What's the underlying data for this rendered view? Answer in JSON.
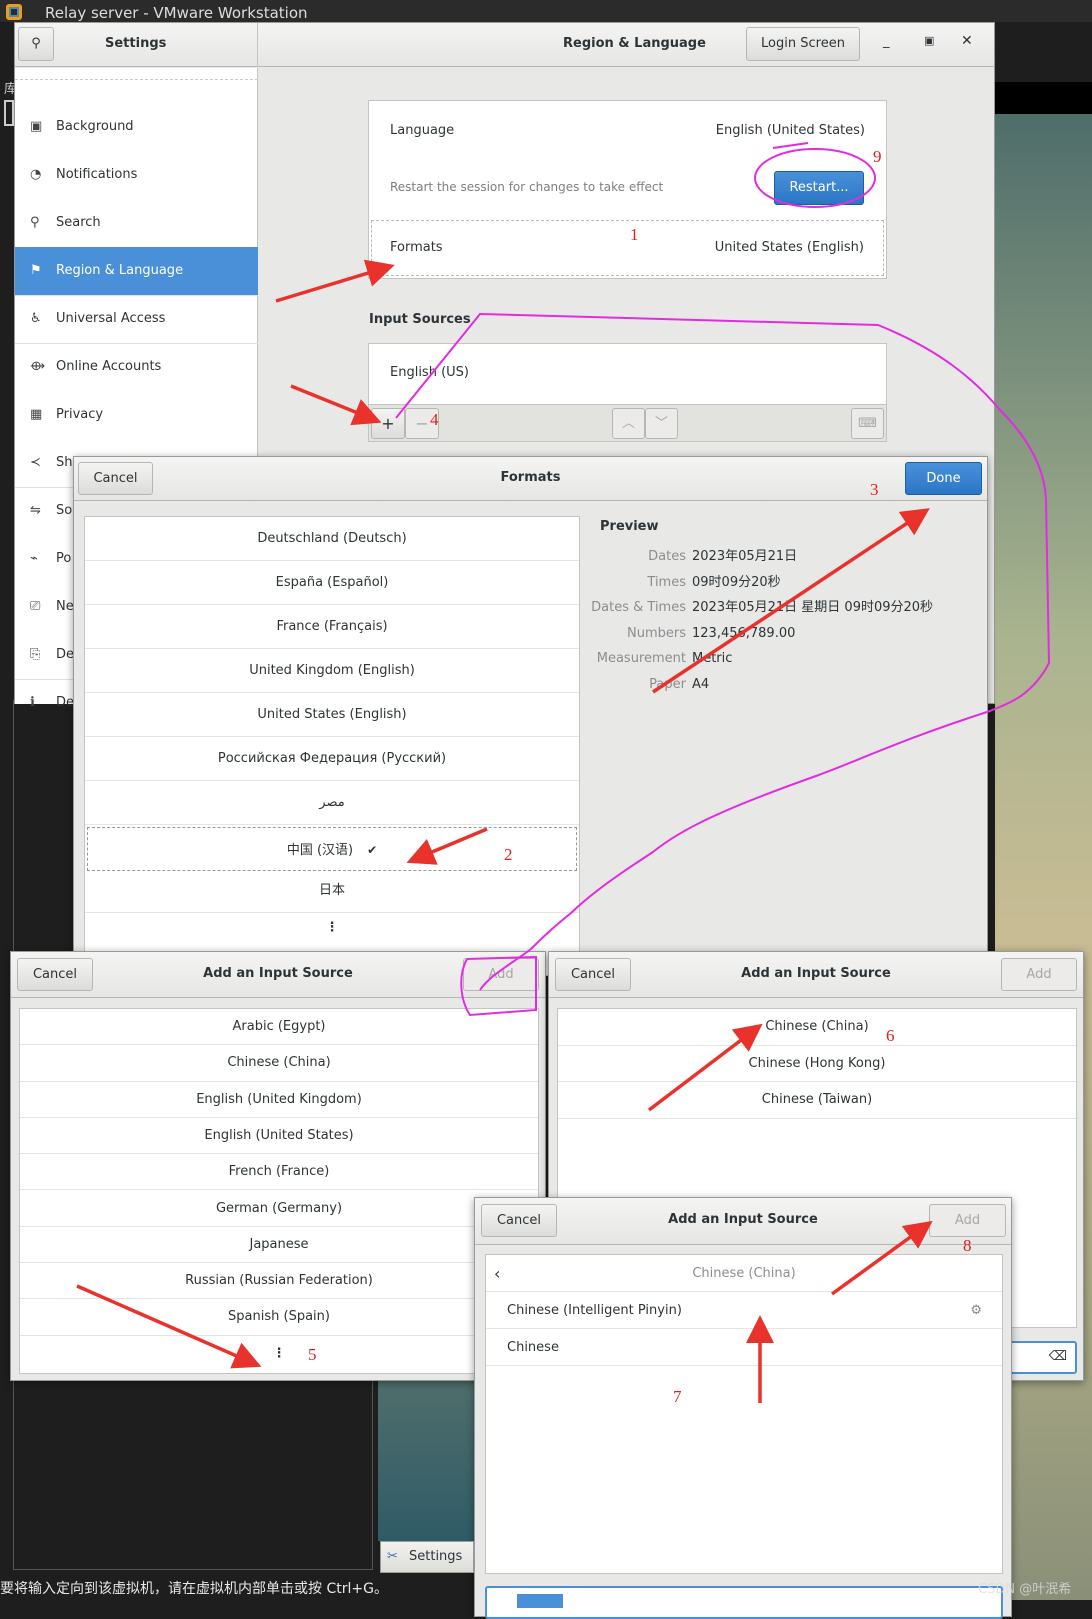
{
  "vmware": {
    "title": "Relay server - VMware Workstation",
    "status_text": "要将输入定向到该虚拟机，请在虚拟机内部单击或按 Ctrl+G。",
    "taskbar_item": "Settings",
    "left_char": "库",
    "watermark": "CSDN @叶泯希"
  },
  "settings": {
    "header_title": "Settings",
    "panel_title": "Region & Language",
    "login_screen": "Login Screen",
    "sidebar": [
      {
        "label": "Background",
        "icon": "▣"
      },
      {
        "label": "Notifications",
        "icon": "◔"
      },
      {
        "label": "Search",
        "icon": "⚲"
      },
      {
        "label": "Region & Language",
        "icon": "⚑",
        "selected": true
      },
      {
        "label": "Universal Access",
        "icon": "♿"
      },
      {
        "label": "Online Accounts",
        "icon": "⟴"
      },
      {
        "label": "Privacy",
        "icon": "▦"
      },
      {
        "label": "Sharing",
        "icon": "≺"
      },
      {
        "label": "So",
        "icon": "⇋"
      },
      {
        "label": "Po",
        "icon": "⌁"
      },
      {
        "label": "Ne",
        "icon": "⎚"
      },
      {
        "label": "De",
        "icon": "⎘"
      },
      {
        "label": "De",
        "icon": "ℹ"
      }
    ],
    "language_label": "Language",
    "language_value": "English (United States)",
    "restart_note": "Restart the session for changes to take effect",
    "restart_button": "Restart...",
    "formats_label": "Formats",
    "formats_value": "United States (English)",
    "input_sources_title": "Input Sources",
    "input_sources": [
      "English (US)"
    ],
    "add": "+",
    "remove": "−"
  },
  "formats_dialog": {
    "cancel": "Cancel",
    "title": "Formats",
    "done": "Done",
    "regions": [
      "Deutschland (Deutsch)",
      "España (Español)",
      "France (Français)",
      "United Kingdom (English)",
      "United States (English)",
      "Российская Федерация (Русский)",
      "مصر",
      "中国 (汉语)",
      "日本"
    ],
    "selected_index": 7,
    "check": "✔",
    "more": "⋮",
    "preview_title": "Preview",
    "preview": [
      {
        "label": "Dates",
        "value": "2023年05月21日"
      },
      {
        "label": "Times",
        "value": "09时09分20秒"
      },
      {
        "label": "Dates & Times",
        "value": "2023年05月21日 星期日 09时09分20秒"
      },
      {
        "label": "Numbers",
        "value": "123,456,789.00"
      },
      {
        "label": "Measurement",
        "value": "Metric"
      },
      {
        "label": "Paper",
        "value": "A4"
      }
    ]
  },
  "input_dialog_1": {
    "cancel": "Cancel",
    "title": "Add an Input Source",
    "add": "Add",
    "items": [
      "Arabic (Egypt)",
      "Chinese (China)",
      "English (United Kingdom)",
      "English (United States)",
      "French (France)",
      "German (Germany)",
      "Japanese",
      "Russian (Russian Federation)",
      "Spanish (Spain)"
    ],
    "more": "⋮"
  },
  "input_dialog_2": {
    "cancel": "Cancel",
    "title": "Add an Input Source",
    "add": "Add",
    "items": [
      "Chinese (China)",
      "Chinese (Hong Kong)",
      "Chinese (Taiwan)"
    ]
  },
  "input_dialog_3": {
    "cancel": "Cancel",
    "title": "Add an Input Source",
    "add": "Add",
    "back_title": "Chinese (China)",
    "items": [
      "Chinese (Intelligent Pinyin)",
      "Chinese"
    ]
  },
  "annotations": {
    "numbers": [
      "1",
      "2",
      "3",
      "4",
      "5",
      "6",
      "7",
      "8",
      "9"
    ],
    "arrow_color": "#e8322b",
    "loop_color": "#e22ce0"
  },
  "colors": {
    "accent": "#4a90d9",
    "window_bg": "#e8e8e7"
  }
}
